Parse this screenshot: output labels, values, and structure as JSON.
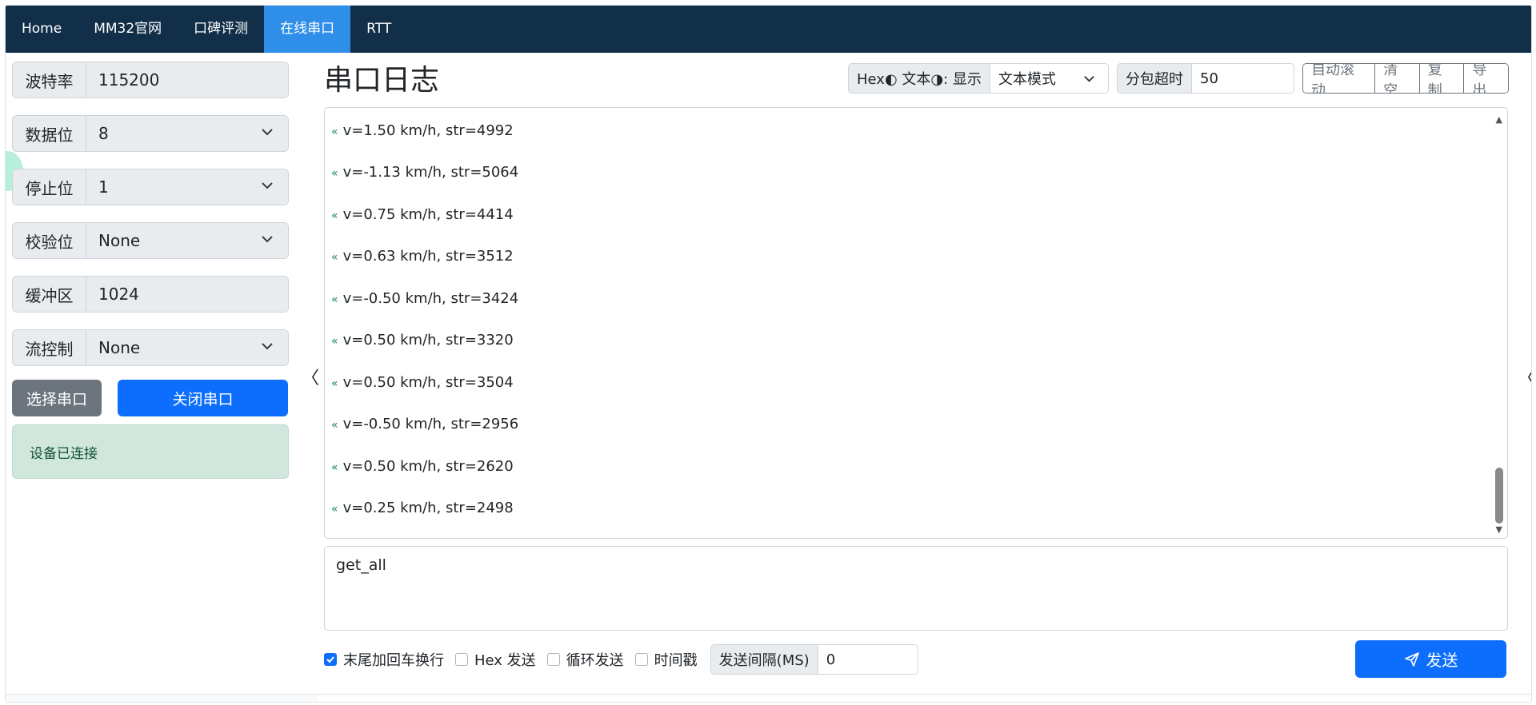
{
  "nav": {
    "items": [
      {
        "label": "Home",
        "active": false
      },
      {
        "label": "MM32官网",
        "active": false
      },
      {
        "label": "口碑评测",
        "active": false
      },
      {
        "label": "在线串口",
        "active": true
      },
      {
        "label": "RTT",
        "active": false
      }
    ]
  },
  "sidebar": {
    "fields": [
      {
        "label": "波特率",
        "value": "115200",
        "type": "input"
      },
      {
        "label": "数据位",
        "value": "8",
        "type": "select"
      },
      {
        "label": "停止位",
        "value": "1",
        "type": "select"
      },
      {
        "label": "校验位",
        "value": "None",
        "type": "select"
      },
      {
        "label": "缓冲区",
        "value": "1024",
        "type": "input"
      },
      {
        "label": "流控制",
        "value": "None",
        "type": "select"
      }
    ],
    "select_port_label": "选择串口",
    "close_port_label": "关闭串口",
    "status_text": "设备已连接"
  },
  "main": {
    "title": "串口日志",
    "display_label": "Hex◐ 文本◑: 显示",
    "display_mode": "文本模式",
    "timeout_label": "分包超时",
    "timeout_value": "50",
    "buttons": {
      "auto_scroll": "自动滚动",
      "clear": "清空",
      "copy": "复制",
      "export": "导出"
    },
    "log_prefix": "«",
    "log": [
      "v=1.50 km/h, str=4992",
      "v=-1.13 km/h, str=5064",
      "v=0.75 km/h, str=4414",
      "v=0.63 km/h, str=3512",
      "v=-0.50 km/h, str=3424",
      "v=0.50 km/h, str=3320",
      "v=0.50 km/h, str=3504",
      "v=-0.50 km/h, str=2956",
      "v=0.50 km/h, str=2620",
      "v=0.25 km/h, str=2498"
    ],
    "send_text": "get_all",
    "options": {
      "crlf": {
        "label": "末尾加回车换行",
        "checked": true
      },
      "hex_send": {
        "label": "Hex 发送",
        "checked": false
      },
      "loop_send": {
        "label": "循环发送",
        "checked": false
      },
      "timestamp": {
        "label": "时间戳",
        "checked": false
      }
    },
    "interval_label": "发送间隔(MS)",
    "interval_value": "0",
    "send_label": "发送"
  },
  "colors": {
    "navbar": "#112f49",
    "nav_active": "#2f8fe8",
    "primary": "#0d6efd",
    "secondary": "#6c757d",
    "success_bg": "#d1e7dd",
    "log_arrow": "#198754"
  }
}
